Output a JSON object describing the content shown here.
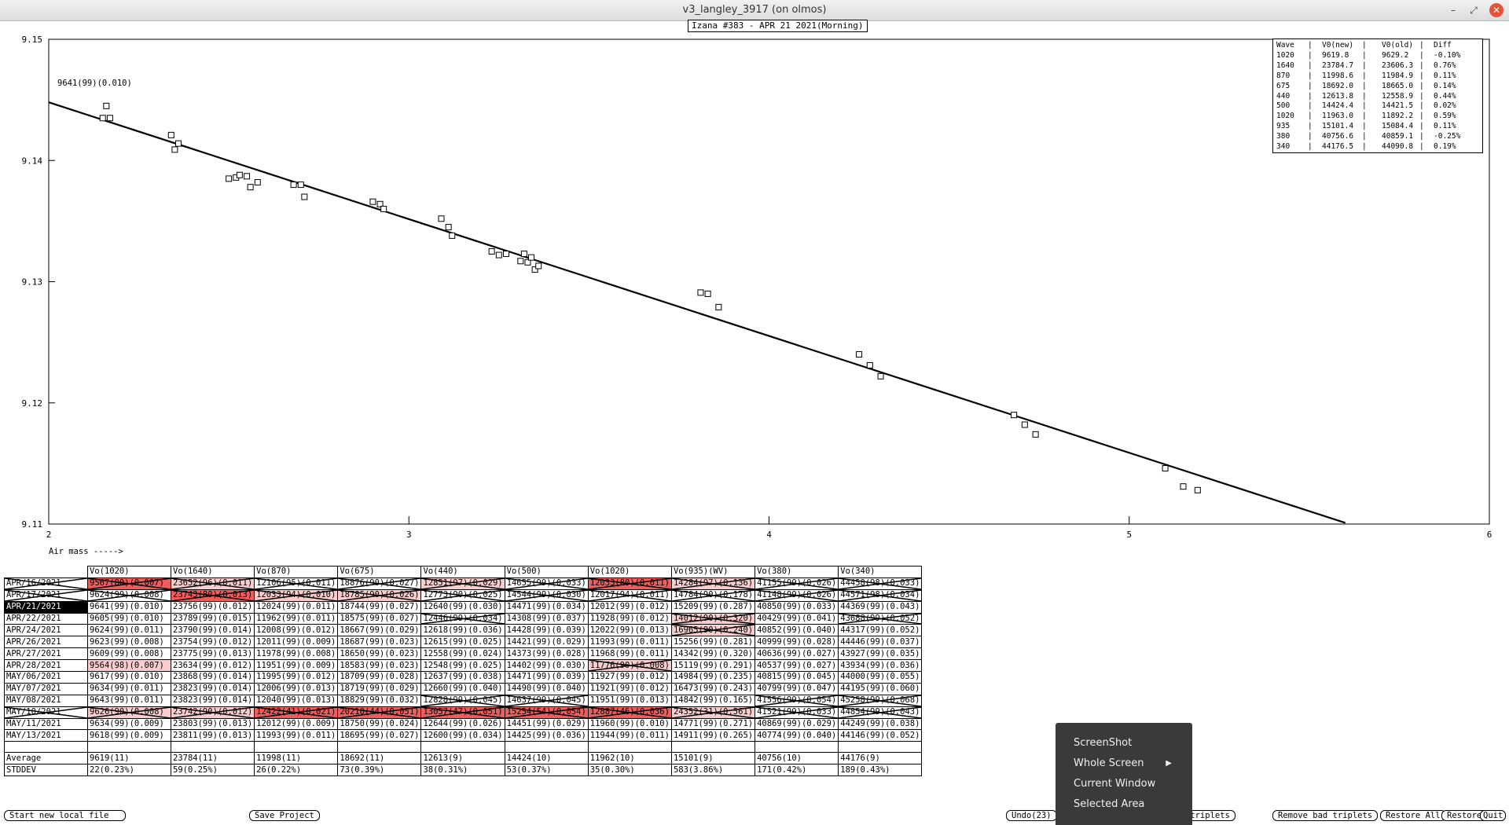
{
  "window": {
    "title": "v3_langley_3917 (on olmos)",
    "minimize_glyph": "–",
    "maximize_glyph": "⤢",
    "close_glyph": "✕"
  },
  "chart_data": {
    "type": "scatter",
    "title": "Izana #383 - APR 21 2021(Morning)",
    "xlabel": "Air mass ----->",
    "ylabel": "",
    "xlim": [
      2,
      6
    ],
    "ylim": [
      9.11,
      9.15
    ],
    "x_ticks": [
      "2",
      "3",
      "4",
      "5",
      "6"
    ],
    "y_ticks": [
      "9.11",
      "9.12",
      "9.13",
      "9.14",
      "9.15"
    ],
    "annotation": "9641(99)(0.010)",
    "fit_line": {
      "x": [
        2.0,
        5.6
      ],
      "y": [
        9.1448,
        9.1101
      ]
    },
    "points": [
      [
        2.16,
        9.1445
      ],
      [
        2.15,
        9.1435
      ],
      [
        2.17,
        9.1435
      ],
      [
        2.34,
        9.1421
      ],
      [
        2.36,
        9.1414
      ],
      [
        2.35,
        9.1409
      ],
      [
        2.5,
        9.1385
      ],
      [
        2.52,
        9.1386
      ],
      [
        2.53,
        9.1388
      ],
      [
        2.55,
        9.1387
      ],
      [
        2.56,
        9.1378
      ],
      [
        2.58,
        9.1382
      ],
      [
        2.68,
        9.138
      ],
      [
        2.7,
        9.138
      ],
      [
        2.71,
        9.137
      ],
      [
        2.9,
        9.1366
      ],
      [
        2.92,
        9.1364
      ],
      [
        2.93,
        9.136
      ],
      [
        3.09,
        9.1352
      ],
      [
        3.11,
        9.1345
      ],
      [
        3.12,
        9.1338
      ],
      [
        3.23,
        9.1325
      ],
      [
        3.25,
        9.1322
      ],
      [
        3.27,
        9.1323
      ],
      [
        3.31,
        9.1317
      ],
      [
        3.32,
        9.1323
      ],
      [
        3.33,
        9.1316
      ],
      [
        3.34,
        9.132
      ],
      [
        3.35,
        9.131
      ],
      [
        3.36,
        9.1313
      ],
      [
        3.81,
        9.1291
      ],
      [
        3.83,
        9.129
      ],
      [
        3.86,
        9.1279
      ],
      [
        4.25,
        9.124
      ],
      [
        4.28,
        9.1231
      ],
      [
        4.31,
        9.1222
      ],
      [
        4.68,
        9.119
      ],
      [
        4.71,
        9.1182
      ],
      [
        4.74,
        9.1174
      ],
      [
        5.1,
        9.1146
      ],
      [
        5.15,
        9.1131
      ],
      [
        5.19,
        9.1128
      ]
    ]
  },
  "legend": {
    "headers": [
      "Wave",
      "|",
      "V0(new)",
      "|",
      "V0(old)",
      "|",
      "Diff"
    ],
    "rows": [
      [
        "1020",
        "|",
        "9619.8",
        "|",
        "9629.2",
        "|",
        "-0.10%"
      ],
      [
        "1640",
        "|",
        "23784.7",
        "|",
        "23606.3",
        "|",
        "0.76%"
      ],
      [
        "870",
        "|",
        "11998.6",
        "|",
        "11984.9",
        "|",
        "0.11%"
      ],
      [
        "675",
        "|",
        "18692.0",
        "|",
        "18665.0",
        "|",
        "0.14%"
      ],
      [
        "440",
        "|",
        "12613.8",
        "|",
        "12558.9",
        "|",
        "0.44%"
      ],
      [
        "500",
        "|",
        "14424.4",
        "|",
        "14421.5",
        "|",
        "0.02%"
      ],
      [
        "1020",
        "|",
        "11963.0",
        "|",
        "11892.2",
        "|",
        "0.59%"
      ],
      [
        "935",
        "|",
        "15101.4",
        "|",
        "15084.4",
        "|",
        "0.11%"
      ],
      [
        "380",
        "|",
        "40756.6",
        "|",
        "40859.1",
        "|",
        "-0.25%"
      ],
      [
        "340",
        "|",
        "44176.5",
        "|",
        "44090.8",
        "|",
        "0.19%"
      ]
    ]
  },
  "table": {
    "columns": [
      "",
      "Vo(1020)",
      "Vo(1640)",
      "Vo(870)",
      "Vo(675)",
      "Vo(440)",
      "Vo(500)",
      "Vo(1020)",
      "Vo(935)(WV)",
      "Vo(380)",
      "Vo(340)"
    ],
    "rows": [
      {
        "cells": [
          "APR/16/2021",
          "9567(80)(0.007)",
          "23652(96)(0.011)",
          "12106(95)(0.011)",
          "18876(90)(0.027)",
          "12851(97)(0.029)",
          "14655(99)(0.033)",
          "12033(80)(0.011)",
          "14284(97)(0.136)",
          "41155(99)(0.026)",
          "44458(98)(0.033)"
        ],
        "styles": [
          "struck",
          "red struck",
          "pink struck",
          "struck",
          "struck",
          "pink struck",
          "struck",
          "red struck",
          "pink struck",
          "struck",
          "struck"
        ]
      },
      {
        "cells": [
          "APR/17/2021",
          "9624(99)(0.008)",
          "23743(80)(0.013)",
          "12033(94)(0.010)",
          "18785(90)(0.026)",
          "12773(90)(0.025)",
          "14544(99)(0.030)",
          "12017(94)(0.011)",
          "14784(90)(0.178)",
          "41148(99)(0.026)",
          "44571(98)(0.034)"
        ],
        "styles": [
          "struck",
          "struck",
          "red struck",
          "pink struck",
          "pink struck",
          "struck",
          "struck",
          "struck",
          "struck",
          "struck",
          "struck"
        ]
      },
      {
        "cells": [
          "APR/21/2021",
          "9641(99)(0.010)",
          "23756(99)(0.012)",
          "12024(99)(0.011)",
          "18744(99)(0.027)",
          "12640(99)(0.030)",
          "14471(99)(0.034)",
          "12012(99)(0.012)",
          "15209(99)(0.287)",
          "40850(99)(0.033)",
          "44369(99)(0.043)"
        ],
        "styles": [
          "sel",
          "",
          "",
          "",
          "",
          "",
          "",
          "",
          "",
          "",
          ""
        ]
      },
      {
        "cells": [
          "APR/22/2021",
          "9605(99)(0.010)",
          "23789(99)(0.015)",
          "11962(99)(0.011)",
          "18575(99)(0.027)",
          "12446(99)(0.034)",
          "14308(99)(0.037)",
          "11928(99)(0.012)",
          "14012(90)(0.320)",
          "40429(99)(0.041)",
          "43688(99)(0.052)"
        ],
        "styles": [
          "",
          "",
          "",
          "",
          "",
          "struck",
          "",
          "",
          "pink struck",
          "",
          "struck"
        ]
      },
      {
        "cells": [
          "APR/24/2021",
          "9624(99)(0.011)",
          "23790(99)(0.014)",
          "12008(99)(0.012)",
          "18667(99)(0.029)",
          "12618(99)(0.036)",
          "14428(99)(0.039)",
          "12022(99)(0.013)",
          "16965(90)(0.240)",
          "40852(99)(0.040)",
          "44317(99)(0.052)"
        ],
        "styles": [
          "",
          "",
          "",
          "",
          "",
          "",
          "",
          "",
          "pink struck",
          "",
          ""
        ]
      },
      {
        "cells": [
          "APR/26/2021",
          "9623(99)(0.008)",
          "23754(99)(0.012)",
          "12011(99)(0.009)",
          "18687(99)(0.023)",
          "12615(99)(0.025)",
          "14421(99)(0.029)",
          "11993(99)(0.011)",
          "15256(99)(0.281)",
          "40999(99)(0.028)",
          "44446(99)(0.037)"
        ],
        "styles": [
          "",
          "",
          "",
          "",
          "",
          "",
          "",
          "",
          "",
          "",
          ""
        ]
      },
      {
        "cells": [
          "APR/27/2021",
          "9609(99)(0.008)",
          "23775(99)(0.013)",
          "11978(99)(0.008)",
          "18650(99)(0.023)",
          "12558(99)(0.024)",
          "14373(99)(0.028)",
          "11968(99)(0.011)",
          "14342(99)(0.320)",
          "40636(99)(0.027)",
          "43927(99)(0.035)"
        ],
        "styles": [
          "",
          "",
          "",
          "",
          "",
          "",
          "",
          "",
          "",
          "",
          ""
        ]
      },
      {
        "cells": [
          "APR/28/2021",
          "9564(98)(0.007)",
          "23634(99)(0.012)",
          "11951(99)(0.009)",
          "18583(99)(0.023)",
          "12548(99)(0.025)",
          "14402(99)(0.030)",
          "11776(90)(0.008)",
          "15119(99)(0.291)",
          "40537(99)(0.027)",
          "43934(99)(0.036)"
        ],
        "styles": [
          "",
          "pink",
          "",
          "",
          "",
          "",
          "",
          "pink struck",
          "",
          "",
          ""
        ]
      },
      {
        "cells": [
          "MAY/06/2021",
          "9617(99)(0.010)",
          "23868(99)(0.014)",
          "11995(99)(0.012)",
          "18709(99)(0.028)",
          "12637(99)(0.038)",
          "14471(99)(0.039)",
          "11927(99)(0.012)",
          "14984(99)(0.235)",
          "40815(99)(0.045)",
          "44000(99)(0.055)"
        ],
        "styles": [
          "",
          "",
          "",
          "",
          "",
          "",
          "",
          "",
          "",
          "",
          ""
        ]
      },
      {
        "cells": [
          "MAY/07/2021",
          "9634(99)(0.011)",
          "23823(99)(0.014)",
          "12006(99)(0.013)",
          "18719(99)(0.029)",
          "12660(99)(0.040)",
          "14490(99)(0.040)",
          "11921(99)(0.012)",
          "16473(99)(0.243)",
          "40799(99)(0.047)",
          "44195(99)(0.060)"
        ],
        "styles": [
          "",
          "",
          "",
          "",
          "",
          "",
          "",
          "",
          "",
          "",
          ""
        ]
      },
      {
        "cells": [
          "MAY/08/2021",
          "9643(99)(0.011)",
          "23823(99)(0.014)",
          "12040(99)(0.013)",
          "18829(99)(0.032)",
          "12828(99)(0.045)",
          "14637(99)(0.045)",
          "11951(99)(0.013)",
          "14842(99)(0.165)",
          "41556(99)(0.054)",
          "45258(99)(0.068)"
        ],
        "styles": [
          "",
          "",
          "",
          "",
          "",
          "struck",
          "struck",
          "",
          "",
          "struck",
          "struck"
        ]
      },
      {
        "cells": [
          "MAY/10/2021",
          "9626(90)(0.008)",
          "23742(90)(0.012)",
          "12422(41)(0.021)",
          "20210(44)(0.051)",
          "13057(47)(0.051)",
          "15254(54)(0.054)",
          "12887(46)(0.036)",
          "24352(31)(0.561)",
          "41521(99)(0.033)",
          "44854(99)(0.043)"
        ],
        "styles": [
          "struck",
          "pink struck",
          "pink struck",
          "red struck",
          "red struck",
          "red struck",
          "red struck",
          "red struck",
          "pink struck",
          "struck",
          "struck"
        ]
      },
      {
        "cells": [
          "MAY/11/2021",
          "9634(99)(0.009)",
          "23803(99)(0.013)",
          "12012(99)(0.009)",
          "18750(99)(0.024)",
          "12644(99)(0.026)",
          "14451(99)(0.029)",
          "11960(99)(0.010)",
          "14771(99)(0.271)",
          "40869(99)(0.029)",
          "44249(99)(0.038)"
        ],
        "styles": [
          "",
          "",
          "",
          "",
          "",
          "",
          "",
          "",
          "",
          "",
          ""
        ]
      },
      {
        "cells": [
          "MAY/13/2021",
          "9618(99)(0.009)",
          "23811(99)(0.013)",
          "11993(99)(0.011)",
          "18695(99)(0.027)",
          "12600(99)(0.034)",
          "14425(99)(0.036)",
          "11944(99)(0.011)",
          "14911(99)(0.265)",
          "40774(99)(0.040)",
          "44146(99)(0.052)"
        ],
        "styles": [
          "",
          "",
          "",
          "",
          "",
          "",
          "",
          "",
          "",
          "",
          ""
        ]
      }
    ],
    "average": [
      "Average",
      "9619(11)",
      "23784(11)",
      "11998(11)",
      "18692(11)",
      "12613(9)",
      "14424(10)",
      "11962(10)",
      "15101(9)",
      "40756(10)",
      "44176(9)"
    ],
    "stddev": [
      "STDDEV",
      "22(0.23%)",
      "59(0.25%)",
      "26(0.22%)",
      "73(0.39%)",
      "38(0.31%)",
      "53(0.37%)",
      "35(0.30%)",
      "583(3.86%)",
      "171(0.42%)",
      "189(0.43%)"
    ]
  },
  "buttons": {
    "start_new": "Start new local file",
    "save_project": "Save Project",
    "undo": "Undo(23)",
    "bad_triplets": "bad triplets",
    "remove_bad": "Remove bad triplets",
    "restore_all": "Restore All",
    "restore": "Restore",
    "quit": "Quit"
  },
  "context_menu": {
    "items": [
      "ScreenShot",
      "Whole Screen",
      "Current Window",
      "Selected Area"
    ],
    "submenu_arrow": "▶"
  }
}
